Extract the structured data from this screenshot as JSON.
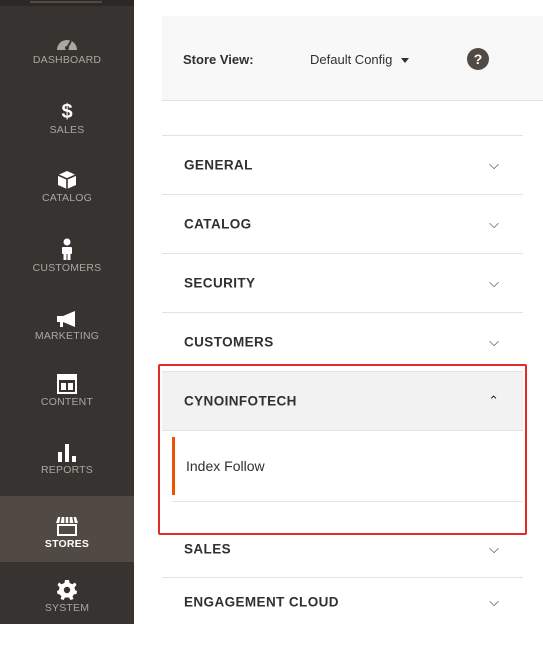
{
  "sidebar": {
    "items": [
      {
        "label": "DASHBOARD",
        "icon": "dashboard-icon"
      },
      {
        "label": "SALES",
        "icon": "dollar-icon"
      },
      {
        "label": "CATALOG",
        "icon": "box-icon"
      },
      {
        "label": "CUSTOMERS",
        "icon": "person-icon"
      },
      {
        "label": "MARKETING",
        "icon": "megaphone-icon"
      },
      {
        "label": "CONTENT",
        "icon": "layout-icon"
      },
      {
        "label": "REPORTS",
        "icon": "bar-chart-icon"
      },
      {
        "label": "STORES",
        "icon": "store-icon"
      },
      {
        "label": "SYSTEM",
        "icon": "gear-icon"
      }
    ],
    "active": "STORES"
  },
  "store_bar": {
    "label": "Store View:",
    "selected": "Default Config",
    "help": "?"
  },
  "sections": [
    {
      "title": "GENERAL",
      "chevron": "chevron-down"
    },
    {
      "title": "CATALOG",
      "chevron": "chevron-down"
    },
    {
      "title": "SECURITY",
      "chevron": "chevron-down"
    },
    {
      "title": "CUSTOMERS",
      "chevron": "chevron-down"
    },
    {
      "title": "CYNOINFOTECH",
      "chevron": "chevron-up",
      "children": [
        {
          "label": "Index Follow"
        }
      ]
    },
    {
      "title": "SALES",
      "chevron": "chevron-down"
    },
    {
      "title": "ENGAGEMENT CLOUD",
      "chevron": "chevron-down"
    }
  ],
  "colors": {
    "sidebar_bg": "#373330",
    "sidebar_active": "#514943",
    "accent": "#eb5202",
    "highlight": "#e02b27"
  }
}
